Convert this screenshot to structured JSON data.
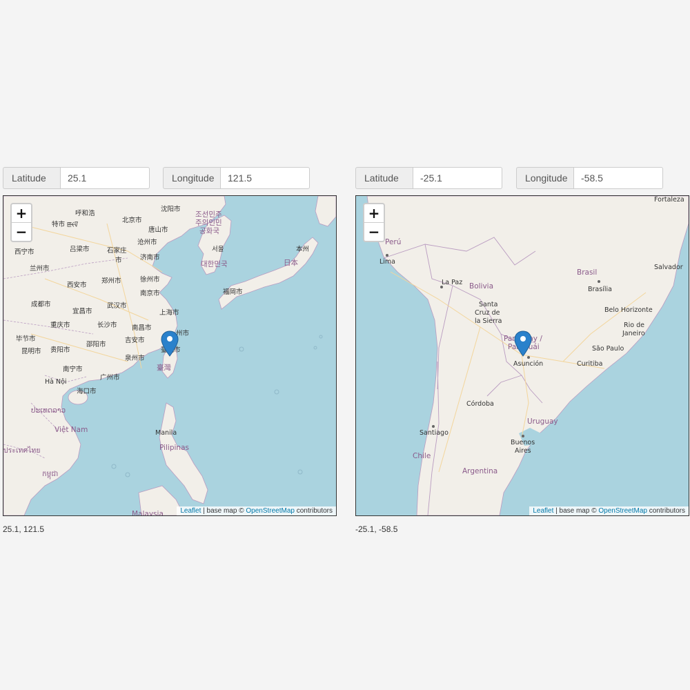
{
  "maps": [
    {
      "latitude_label": "Latitude",
      "latitude_value": "25.1",
      "longitude_label": "Longitude",
      "longitude_value": "121.5",
      "coords_text": "25.1, 121.5",
      "zoom_in": "+",
      "zoom_out": "−",
      "attribution": {
        "leaflet": "Leaflet",
        "middle": " | base map © ",
        "osm": "OpenStreetMap",
        "end": " contributors"
      },
      "labels": {
        "huhehaote": "呼和浩",
        "shenyang": "沈阳市",
        "korea_n": "조선민주",
        "korea_n2": "주의인민",
        "korea_n3": "공화국",
        "baotou": "特市 ꡣꡡꡧ",
        "beijing": "北京市",
        "tangshan": "唐山市",
        "xining": "西宁市",
        "lanzhou": "兰州市",
        "lvliang": "吕梁市",
        "shijiazhuang": "石家庄",
        "shi": "市",
        "cangzhou": "沧州市",
        "jinan": "济南市",
        "seoul": "서울",
        "korea_s": "대한민국",
        "honshu": "本州",
        "japan": "日本",
        "xian": "西安市",
        "zhengzhou": "郑州市",
        "xuzhou": "徐州市",
        "nanjing": "南京市",
        "fukuoka": "福岡市",
        "chengdu": "成都市",
        "yichang": "宜昌市",
        "wuhan": "武汉市",
        "shanghai": "上海市",
        "chongqing": "重庆市",
        "changsha": "长沙市",
        "nanchang": "南昌市",
        "bijie": "毕节市",
        "shaoyang": "邵阳市",
        "jian": "吉安市",
        "taizhou": "州市",
        "kunming": "昆明市",
        "guiyang": "贵阳市",
        "quanzhou": "泉州市",
        "taipei": "臺北市",
        "taiwan": "臺灣",
        "nanning": "南宁市",
        "guangzhou": "广州市",
        "hanoi": "Hà Nội",
        "haikou": "海口市",
        "laos": "ປະເທດລາວ",
        "vietnam": "Việt Nam",
        "manila": "Manila",
        "philippines": "Pilipinas",
        "thailand": "ประเทศไทย",
        "cambodia": "កម្ពុជា",
        "malaysia": "Malaysia"
      }
    },
    {
      "latitude_label": "Latitude",
      "latitude_value": "-25.1",
      "longitude_label": "Longitude",
      "longitude_value": "-58.5",
      "coords_text": "-25.1, -58.5",
      "zoom_in": "+",
      "zoom_out": "−",
      "attribution": {
        "leaflet": "Leaflet",
        "middle": " | base map © ",
        "osm": "OpenStreetMap",
        "end": " contributors"
      },
      "labels": {
        "fortaleza": "Fortaleza",
        "peru": "Perú",
        "lima": "Lima",
        "salvador": "Salvador",
        "brasil": "Brasil",
        "brasilia": "Brasília",
        "lapaz": "La Paz",
        "bolivia": "Bolivia",
        "santa": "Santa",
        "cruz": "Cruz de",
        "sierra": "la Sierra",
        "belo": "Belo Horizonte",
        "rio": "Rio de",
        "janeiro": "Janeiro",
        "paraguay": "Paraguay /",
        "paraguai": "Paraguái",
        "saopaulo": "São Paulo",
        "asuncion": "Asunción",
        "curitiba": "Curitiba",
        "cordoba": "Córdoba",
        "uruguay": "Uruguay",
        "santiago": "Santiago",
        "buenos": "Buenos",
        "aires": "Aires",
        "chile": "Chile",
        "argentina": "Argentina"
      }
    }
  ],
  "colors": {
    "water": "#aad3df",
    "land": "#f2efe9",
    "marker": "#2a81cb",
    "border": "#b99bc0",
    "road": "#f3d59b"
  }
}
